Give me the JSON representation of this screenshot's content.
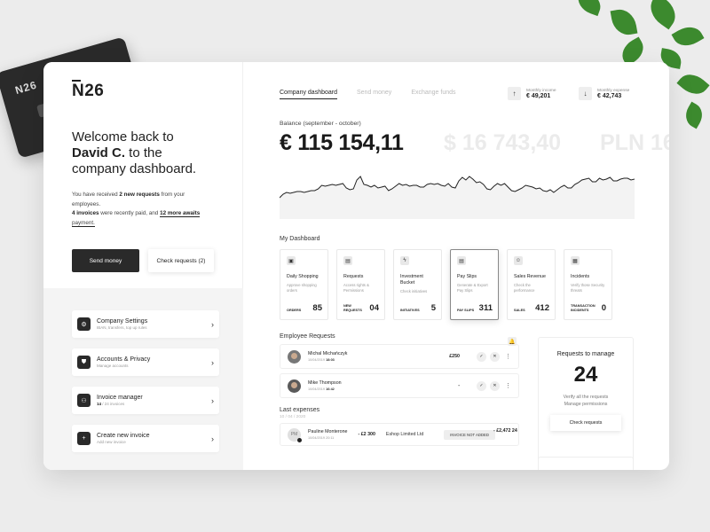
{
  "brand": {
    "logo": "N26",
    "card_logo": "N26"
  },
  "welcome": {
    "line1": "Welcome back to",
    "name": "David C.",
    "line2_rest": " to the",
    "line3": "company dashboard."
  },
  "info": {
    "part1": "You have received ",
    "new_requests": "2 new requests",
    "part2": " from your employees.",
    "invoices_paid": "4 invoices",
    "part3": " were recently paid, and ",
    "more_awaits": "12 more awaits",
    "part4": "payment."
  },
  "actions": {
    "send_money": "Send money",
    "check_requests": "Check requests (2)"
  },
  "menu": [
    {
      "title": "Company Settings",
      "sub": "IBAN, transfers, top up rules",
      "icon": "gear-icon",
      "glyph": "⚙"
    },
    {
      "title": "Accounts & Privacy",
      "sub": "Manage accounts",
      "icon": "shield-icon",
      "glyph": "⛊"
    },
    {
      "title": "Invoice manager",
      "sub_bold": "14",
      "sub": " / 24 invoices",
      "icon": "users-icon",
      "glyph": "⚇"
    },
    {
      "title": "Create new invoice",
      "sub": "Add new invoice",
      "icon": "plus-icon",
      "glyph": "+"
    }
  ],
  "tabs": [
    {
      "label": "Company dashboard",
      "active": true
    },
    {
      "label": "Send money",
      "active": false
    },
    {
      "label": "Exchange funds",
      "active": false
    }
  ],
  "stats": {
    "income": {
      "label": "Monthly income",
      "value": "€ 49,201",
      "icon": "arrow-up-icon"
    },
    "expense": {
      "label": "Monthly expense",
      "value": "€ 42,743",
      "icon": "arrow-down-icon"
    }
  },
  "balance": {
    "label": "Balance (september - october)",
    "main": "€ 115 154,11",
    "usd": "$ 16 743,40",
    "pln": "PLN 16"
  },
  "balance_trend": [
    34,
    30,
    28,
    29,
    28,
    27,
    27,
    28,
    27,
    26,
    26,
    24,
    20,
    21,
    20,
    19,
    20,
    19,
    18,
    23,
    25,
    24,
    14,
    10,
    19,
    20,
    22,
    20,
    23,
    22,
    21,
    26,
    24,
    21,
    18,
    20,
    19,
    21,
    20,
    20,
    22,
    22,
    19,
    18,
    19,
    18,
    20,
    21,
    18,
    22,
    23,
    15,
    11,
    14,
    10,
    13,
    17,
    16,
    19,
    24,
    25,
    21,
    18,
    20,
    18,
    22,
    26,
    27,
    25,
    23,
    20,
    21,
    22,
    24,
    23,
    26,
    27,
    25,
    28,
    25,
    22,
    20,
    23,
    23,
    19,
    17,
    14,
    13,
    12,
    16,
    16,
    12,
    14,
    13,
    11,
    15,
    15,
    13,
    12,
    12,
    14,
    13
  ],
  "dashboard": {
    "label": "My Dashboard",
    "tiles": [
      {
        "title": "Daily Shopping",
        "sub": "Approve shopping orders",
        "key": "ORDERS",
        "value": "85",
        "icon": "bag-icon",
        "glyph": "▣",
        "selected": false
      },
      {
        "title": "Requests",
        "sub": "Access rights & Permissions",
        "key": "NEW REQUESTS",
        "value": "04",
        "icon": "document-icon",
        "glyph": "▤",
        "selected": false
      },
      {
        "title": "Investment Bucket",
        "sub": "Check initiatives",
        "key": "INITIATIVES",
        "value": "5",
        "icon": "lightning-icon",
        "glyph": "ϟ",
        "selected": false
      },
      {
        "title": "Pay Slips",
        "sub": "Generate & Export Pay Slips",
        "key": "PAY SLIPS",
        "value": "311",
        "icon": "payslip-icon",
        "glyph": "▤",
        "selected": true
      },
      {
        "title": "Sales Revenue",
        "sub": "Check the performance",
        "key": "SALES",
        "value": "412",
        "icon": "person-icon",
        "glyph": "☺",
        "selected": false
      },
      {
        "title": "Incidents",
        "sub": "Verify those Security threats",
        "key": "TRANSACTION INCIDENTS",
        "value": "0",
        "icon": "calendar-icon",
        "glyph": "▦",
        "selected": false
      }
    ]
  },
  "employee_requests": {
    "title": "Employee Requests",
    "rows": [
      {
        "name": "Michal Michańczyk",
        "date": "10/04/2019",
        "time": "18:03",
        "amount": "£250"
      },
      {
        "name": "Mike Thompson",
        "date": "10/04/2019",
        "time": "16:42",
        "amount": "-"
      }
    ]
  },
  "expenses": {
    "title": "Last expenses",
    "date": "10 / 04 / 2020",
    "total": "- £2,472 24",
    "rows": [
      {
        "initials": "PM",
        "name": "Pauline Monterone",
        "date": "10/04/2019",
        "time": "20:11",
        "amount": "- £2 300",
        "shop": "Eshop Limited Ltd",
        "status": "INVOICE NOT ADDED"
      }
    ]
  },
  "manage": {
    "title": "Requests to manage",
    "count": "24",
    "line1": "Verify all the requests",
    "line2": "Manage permissions",
    "button": "Check requests"
  }
}
